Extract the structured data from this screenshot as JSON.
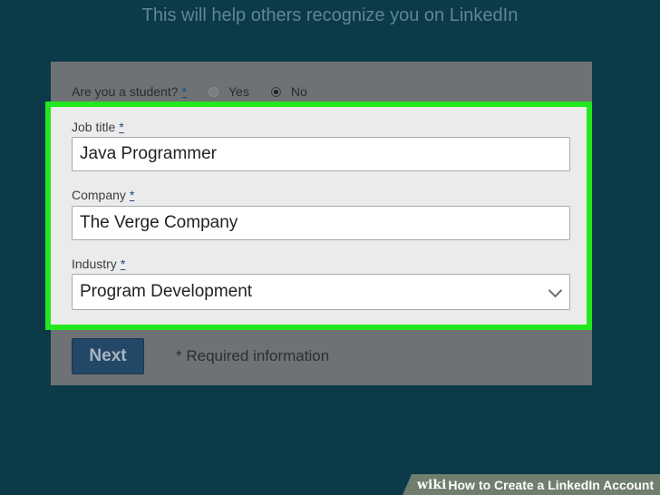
{
  "header": {
    "subtitle": "This will help others recognize you on LinkedIn"
  },
  "student": {
    "question": "Are you a student?",
    "required_mark": "*",
    "yes_label": "Yes",
    "no_label": "No",
    "selected": "No"
  },
  "fields": {
    "job_title": {
      "label": "Job title",
      "required_mark": "*",
      "value": "Java Programmer"
    },
    "company": {
      "label": "Company",
      "required_mark": "*",
      "value": "The Verge Company"
    },
    "industry": {
      "label": "Industry",
      "required_mark": "*",
      "value": "Program Development",
      "icon": "chevron-down-icon"
    }
  },
  "footer": {
    "next_label": "Next",
    "required_info": "* Required information"
  },
  "watermark": {
    "logo": "wiki",
    "how": "How",
    "text": "to Create a LinkedIn Account"
  },
  "colors": {
    "background": "#0b3a49",
    "highlight": "#24e81f",
    "button": "#234767"
  }
}
